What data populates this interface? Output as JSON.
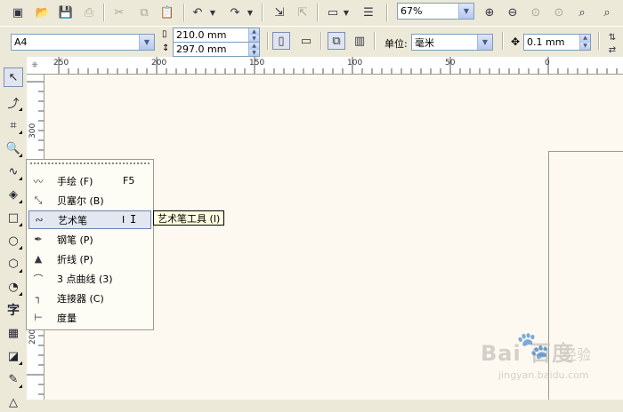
{
  "toolbar": {
    "zoom_value": "67%",
    "icons": [
      "new-icon",
      "open-icon",
      "save-icon",
      "print-icon",
      "cut-icon",
      "copy-icon",
      "paste-icon",
      "undo-icon",
      "redo-icon",
      "import-icon",
      "export-icon",
      "app-launcher-icon",
      "options-icon",
      "zoom-in-icon",
      "zoom-out-icon",
      "zoom-selected-icon",
      "zoom-all-icon",
      "zoom-page-icon",
      "zoom-width-icon"
    ]
  },
  "property_bar": {
    "page_size": "A4",
    "width": "210.0 mm",
    "height": "297.0 mm",
    "unit_label": "单位:",
    "unit_value": "毫米",
    "nudge_value": "0.1 mm"
  },
  "ruler": {
    "top_labels": [
      "250",
      "200",
      "150",
      "100",
      "50",
      "0"
    ],
    "left_labels": [
      "300",
      "250",
      "200"
    ]
  },
  "toolbox": {
    "text_tool_glyph": "字"
  },
  "flyout": {
    "items": [
      {
        "icon": "freehand-icon",
        "label": "手绘",
        "accel": "(F)",
        "key": "F5"
      },
      {
        "icon": "bezier-icon",
        "label": "贝塞尔",
        "accel": "(B)",
        "key": ""
      },
      {
        "icon": "artistic-media-icon",
        "label": "艺术笔",
        "accel": "",
        "key": "I"
      },
      {
        "icon": "pen-icon",
        "label": "钢笔",
        "accel": "(P)",
        "key": ""
      },
      {
        "icon": "polyline-icon",
        "label": "折线",
        "accel": "(P)",
        "key": ""
      },
      {
        "icon": "three-point-curve-icon",
        "label": "3 点曲线",
        "accel": "(3)",
        "key": ""
      },
      {
        "icon": "connector-icon",
        "label": "连接器",
        "accel": "(C)",
        "key": ""
      },
      {
        "icon": "dimension-icon",
        "label": "度量",
        "accel": "",
        "key": ""
      }
    ],
    "highlighted_index": 2
  },
  "tooltip": {
    "text": "艺术笔工具 (I)"
  },
  "watermark": {
    "logo": "Bai  百度",
    "suffix": "经验",
    "url": "jingyan.baidu.com"
  }
}
